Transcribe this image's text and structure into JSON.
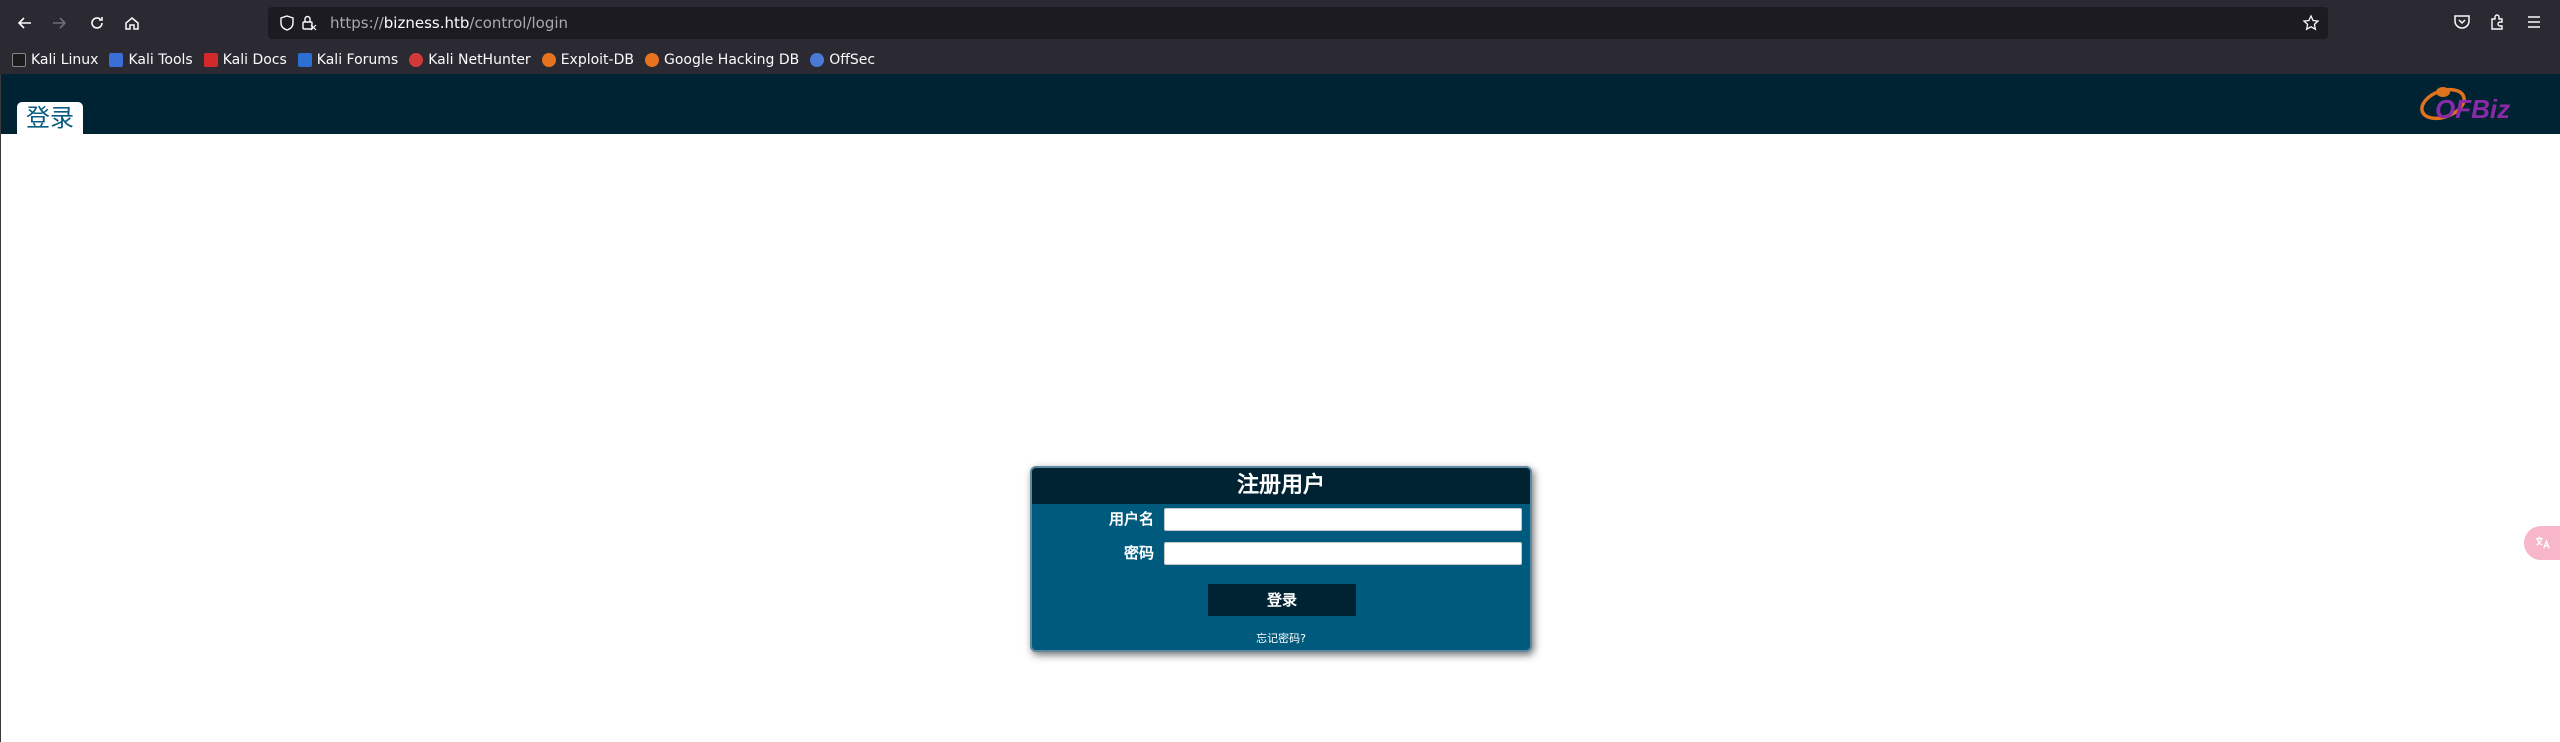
{
  "browser": {
    "url_prefix": "https://",
    "url_host": "bizness.htb",
    "url_path": "/control/login",
    "bookmarks": [
      {
        "label": "Kali Linux",
        "color": "#1b1b1b"
      },
      {
        "label": "Kali Tools",
        "color": "#3a6fd8"
      },
      {
        "label": "Kali Docs",
        "color": "#d22a2a"
      },
      {
        "label": "Kali Forums",
        "color": "#2b6fd1"
      },
      {
        "label": "Kali NetHunter",
        "color": "#d23a3a"
      },
      {
        "label": "Exploit-DB",
        "color": "#e8731e"
      },
      {
        "label": "Google Hacking DB",
        "color": "#e8731e"
      },
      {
        "label": "OffSec",
        "color": "#4a7ad6"
      }
    ]
  },
  "app": {
    "tab_label": "登录",
    "header_color": "#002333",
    "logo_text": "OFBiz"
  },
  "login": {
    "title": "注册用户",
    "username_label": "用户名",
    "password_label": "密码",
    "username_value": "",
    "password_value": "",
    "submit_label": "登录",
    "forgot_label": "忘记密码?"
  }
}
